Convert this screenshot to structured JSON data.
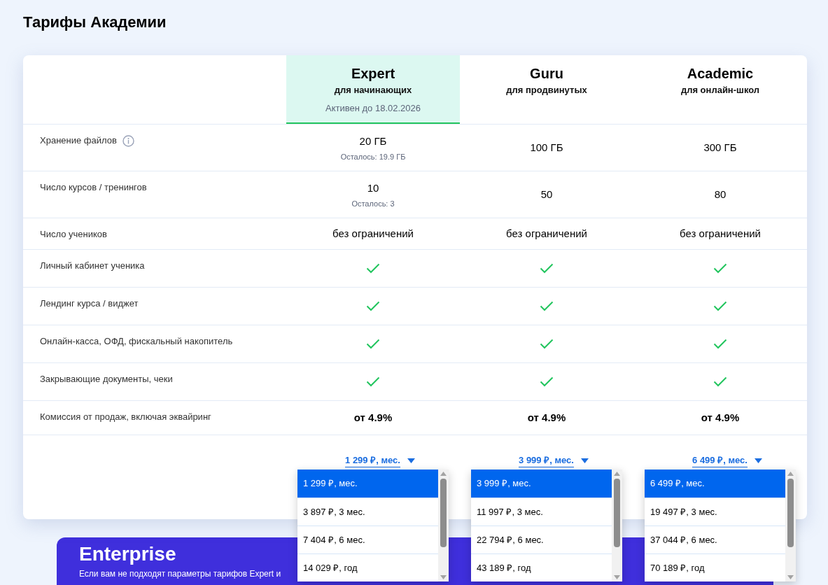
{
  "title": "Тарифы Академии",
  "plans": [
    {
      "name": "Expert",
      "subtitle": "для начинающих",
      "status": "Активен до 18.02.2026",
      "selected": true,
      "price": "1 299 ₽, мес.",
      "price_options": [
        {
          "label": "1 299 ₽, мес.",
          "selected": true
        },
        {
          "label": "3 897 ₽, 3 мес.",
          "selected": false
        },
        {
          "label": "7 404 ₽, 6 мес.",
          "selected": false
        },
        {
          "label": "14 029 ₽, год",
          "selected": false
        }
      ]
    },
    {
      "name": "Guru",
      "subtitle": "для продвинутых",
      "selected": false,
      "price": "3 999 ₽, мес.",
      "price_options": [
        {
          "label": "3 999 ₽, мес.",
          "selected": true
        },
        {
          "label": "11 997 ₽, 3 мес.",
          "selected": false
        },
        {
          "label": "22 794 ₽, 6 мес.",
          "selected": false
        },
        {
          "label": "43 189 ₽, год",
          "selected": false
        }
      ]
    },
    {
      "name": "Academic",
      "subtitle": "для онлайн-школ",
      "selected": false,
      "price": "6 499 ₽, мес.",
      "price_options": [
        {
          "label": "6 499 ₽, мес.",
          "selected": true
        },
        {
          "label": "19 497 ₽, 3 мес.",
          "selected": false
        },
        {
          "label": "37 044 ₽, 6 мес.",
          "selected": false
        },
        {
          "label": "70 189 ₽, год",
          "selected": false
        }
      ]
    }
  ],
  "features": [
    {
      "label": "Хранение файлов",
      "info": true,
      "kind": "text",
      "values": [
        {
          "value": "20 ГБ",
          "note": "Осталось: 19.9 ГБ"
        },
        {
          "value": "100 ГБ"
        },
        {
          "value": "300 ГБ"
        }
      ]
    },
    {
      "label": "Число курсов / тренингов",
      "info": false,
      "kind": "text",
      "values": [
        {
          "value": "10",
          "note": "Осталось: 3"
        },
        {
          "value": "50"
        },
        {
          "value": "80"
        }
      ]
    },
    {
      "label": "Число учеников",
      "info": false,
      "kind": "text",
      "values": [
        {
          "value": "без ограничений"
        },
        {
          "value": "без ограничений"
        },
        {
          "value": "без ограничений"
        }
      ]
    },
    {
      "label": "Личный кабинет ученика",
      "info": false,
      "kind": "check",
      "values": [
        {
          "included": true
        },
        {
          "included": true
        },
        {
          "included": true
        }
      ]
    },
    {
      "label": "Лендинг курса / виджет",
      "info": false,
      "kind": "check",
      "values": [
        {
          "included": true
        },
        {
          "included": true
        },
        {
          "included": true
        }
      ]
    },
    {
      "label": "Онлайн-касса, ОФД, фискальный накопитель",
      "info": false,
      "kind": "check",
      "values": [
        {
          "included": true
        },
        {
          "included": true
        },
        {
          "included": true
        }
      ]
    },
    {
      "label": "Закрывающие документы, чеки",
      "info": false,
      "kind": "check",
      "values": [
        {
          "included": true
        },
        {
          "included": true
        },
        {
          "included": true
        }
      ]
    },
    {
      "label": "Комиссия от продаж, включая эквайринг",
      "info": false,
      "kind": "emphasis",
      "values": [
        {
          "value": "от 4.9%"
        },
        {
          "value": "от 4.9%"
        },
        {
          "value": "от 4.9%"
        }
      ]
    }
  ],
  "enterprise": {
    "title": "Enterprise",
    "text": "Если вам не подходят параметры тарифов Expert и"
  }
}
